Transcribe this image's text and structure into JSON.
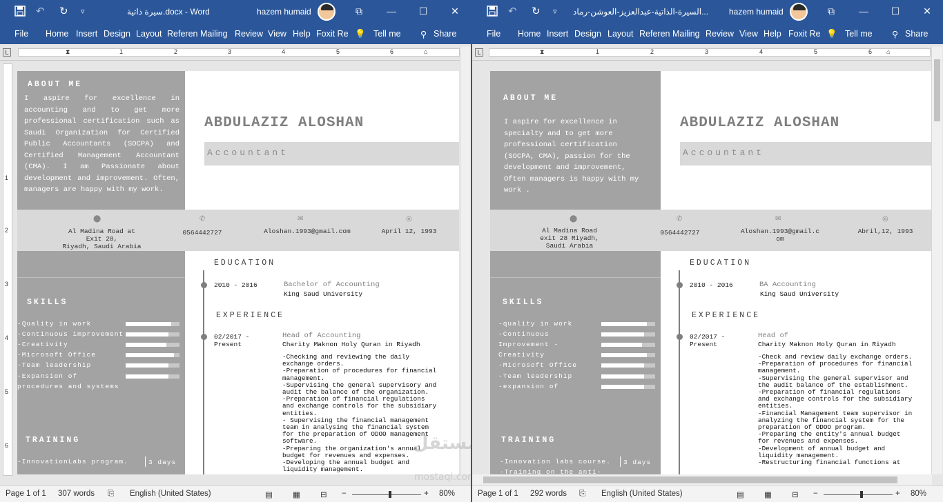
{
  "windows": [
    {
      "doc_title": "سيرة ذاتية.docx - Word",
      "user_name": "hazem humaid",
      "tabs": [
        "File",
        "Home",
        "Insert",
        "Design",
        "Layout",
        "Referen",
        "Mailing",
        "Review",
        "View",
        "Help",
        "Foxit Re"
      ],
      "tell_me": "Tell me",
      "share": "Share",
      "ruler_numbers": [
        "1",
        "1",
        "2",
        "3",
        "4",
        "5",
        "6",
        "7"
      ],
      "vruler_numbers": [
        "1",
        "1",
        "2",
        "3",
        "4",
        "5",
        "6"
      ],
      "cv": {
        "about_heading": "ABOUT ME",
        "about_text": "I aspire for excellence in accounting and to get more professional certification such as Saudi Organization for Certified Public Accountants (SOCPA) and Certified Management Accountant (CMA). I am Passionate about development and improvement. Often, managers are happy with my work.",
        "name": "ABDULAZIZ ALOSHAN",
        "job_title": "Accountant",
        "address": "Al Madina Road at\nExit 28,\nRiyadh, Saudi Arabia",
        "phone": "0564442727",
        "email": "Aloshan.1993@gmail.com",
        "birth": "April 12, 1993",
        "education_heading": "EDUCATION",
        "edu_dates": "2010 - 2016",
        "edu_degree": "Bachelor of Accounting",
        "edu_school": "King Saud University",
        "experience_heading": "EXPERIENCE",
        "exp_dates": "02/2017 -\nPresent",
        "exp_title": "Head of Accounting",
        "exp_company": "Charity Maknon Holy Quran in Riyadh",
        "exp_bullets": [
          "-Checking and reviewing the daily",
          "exchange orders.",
          "-Preparation of procedures for financial",
          "management.",
          "-Supervising the general supervisory and",
          "audit the balance of the organization.",
          "-Preparation of financial regulations",
          "and exchange controls for the subsidiary",
          "entities.",
          "- Supervising the financial management",
          "team in analysing the financial system",
          "for the preparation of ODOO management",
          "software.",
          "-Preparing the organization's annual",
          "budget for revenues and expenses.",
          "-Developing the annual budget and",
          "liquidity management."
        ],
        "skills_heading": "SKILLS",
        "skills": [
          {
            "label": "-Quality in work",
            "level": 0.85
          },
          {
            "label": "-Continuous improvement",
            "level": 0.8
          },
          {
            "label": "-Creativity",
            "level": 0.75
          },
          {
            "label": "-Microsoft Office",
            "level": 0.9
          },
          {
            "label": "-Team leadership",
            "level": 0.8
          },
          {
            "label": "-Expansion of",
            "level": 0.8
          },
          {
            "label": "procedures and systems",
            "level": null
          }
        ],
        "training_heading": "TRAINING",
        "training_items": [
          {
            "label": "-InnovationLabs program.",
            "duration": "3 days"
          }
        ]
      },
      "status": {
        "page": "Page 1 of 1",
        "words": "307 words",
        "language": "English (United States)",
        "zoom": "80%",
        "zoom_level": 0.8
      }
    },
    {
      "doc_title": "السيرة-الذاتية-عبدالعزيز-العوشن-رماد...",
      "user_name": "hazem humaid",
      "tabs": [
        "File",
        "Home",
        "Insert",
        "Design",
        "Layout",
        "Referen",
        "Mailing",
        "Review",
        "View",
        "Help",
        "Foxit Re"
      ],
      "tell_me": "Tell me",
      "share": "Share",
      "ruler_numbers": [
        "1",
        "1",
        "2",
        "3",
        "4",
        "5",
        "6",
        "7"
      ],
      "vruler_numbers": [
        "1",
        "1",
        "2",
        "3",
        "4",
        "5",
        "6"
      ],
      "cv": {
        "about_heading": "ABOUT ME",
        "about_text": "I aspire for excellence in specialty and to get more professional certification (SOCPA, CMA), passion for the development and improvement, Often managers is happy with my work .",
        "name": "ABDULAZIZ ALOSHAN",
        "job_title": "Accountant",
        "address": "Al Madina Road\nexit 28 Riyadh,\nSaudi Arabia",
        "phone": "0564442727",
        "email": "Aloshan.1993@gmail.c\nom",
        "birth": "Abril,12, 1993",
        "education_heading": "EDUCATION",
        "edu_dates": "2010 - 2016",
        "edu_degree": "BA Accounting",
        "edu_school": "King Saud University",
        "experience_heading": "EXPERIENCE",
        "exp_dates": "02/2017 -\nPresent",
        "exp_title": "Head of",
        "exp_company": "Charity Maknon Holy Quran in Riyadh",
        "exp_bullets": [
          "-Check and review daily exchange orders.",
          "-Preparation of procedures for financial",
          "management.",
          "-Supervising the general supervisor and",
          "the audit balance of the establishment.",
          "-Preparation of financial regulations",
          "and exchange controls for the subsidiary",
          "entities.",
          "-Financial Management team supervisor in",
          "analyzing the financial system for the",
          "preparation of ODOO program.",
          "-Preparing the entity's annual budget",
          "for revenues and expenses.",
          "-Development of annual budget and",
          "liquidity management.",
          "-Restructuring financial functions at"
        ],
        "skills_heading": "SKILLS",
        "skills": [
          {
            "label": "-quality in work",
            "level": 0.85
          },
          {
            "label": "-Continuous",
            "level": 0.8
          },
          {
            "label": "Improvement -",
            "level": 0.75
          },
          {
            "label": "Creativity",
            "level": 0.85
          },
          {
            "label": "-Microsoft Office",
            "level": 0.8
          },
          {
            "label": "-Team leadership",
            "level": 0.8
          },
          {
            "label": "-expansion of",
            "level": 0.8
          }
        ],
        "training_heading": "TRAINING",
        "training_items": [
          {
            "label": "-Innovation labs course.",
            "duration": "3 days"
          },
          {
            "label": "-Training on the anti-",
            "duration": ""
          }
        ]
      },
      "status": {
        "page": "Page 1 of 1",
        "words": "292 words",
        "language": "English (United States)",
        "zoom": "80%",
        "zoom_level": 0.8
      }
    }
  ],
  "watermark": {
    "line1": "مستقل",
    "line2": "mostaql.com"
  },
  "colors": {
    "word_blue": "#2b579a",
    "sidebar_gray": "#a3a3a3",
    "band_gray": "#d9d9d9",
    "name_gray": "#7f7f7f"
  },
  "icons": {
    "save": "save-icon",
    "undo": "undo-icon",
    "redo": "redo-icon",
    "customize": "chevron-down-icon",
    "ribbon_display": "ribbon-display-icon",
    "minimize": "minimize-icon",
    "maximize": "maximize-icon",
    "close": "close-icon",
    "lightbulb": "lightbulb-icon",
    "share": "person-icon",
    "location": "location-pin-icon",
    "phone": "phone-icon",
    "email": "envelope-icon",
    "web": "globe-icon"
  }
}
